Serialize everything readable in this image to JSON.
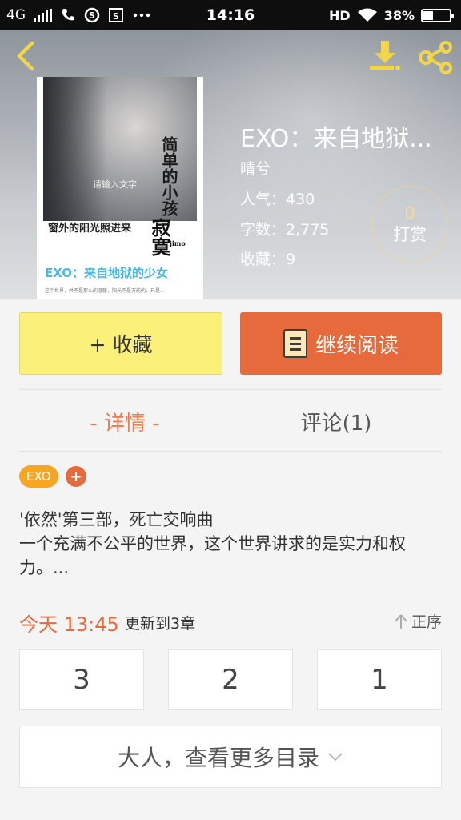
{
  "status_bar": {
    "network": "4G",
    "time": "14:16",
    "hd": "HD",
    "battery_percent": "38%",
    "battery_level": 0.38,
    "icons": [
      "signal-icon",
      "phone-icon",
      "skype-icon",
      "sim-icon",
      "more-dots-icon",
      "wifi-icon",
      "battery-icon"
    ]
  },
  "header": {
    "back_icon": "chevron-left-icon",
    "download_icon": "download-icon",
    "share_icon": "share-icon",
    "icon_color": "#f2d64a"
  },
  "cover": {
    "vertical_text": "简单的小孩",
    "small_text": "请输入文字",
    "line_text": "窗外的阳光照进来",
    "big_text": "寂寞",
    "big_sub": "jimo",
    "title": "EXO：来自地狱的少女",
    "tiny_text": "这个世界，并不是那么的温暖，阳光不是万能的，只是..."
  },
  "book": {
    "title": "EXO：来自地狱...",
    "author": "晴兮",
    "popularity": "人气：430",
    "word_count": "字数：2,775",
    "favorites": "收藏：9",
    "tip_count": "0",
    "tip_label": "打赏"
  },
  "actions": {
    "collect_label": "+ 收藏",
    "read_label": "继续阅读",
    "collect_color": "#fbf07a",
    "read_color": "#e66a3b"
  },
  "tabs": {
    "detail": "- 详情 -",
    "comments": "评论(1)"
  },
  "tags": {
    "items": [
      "EXO"
    ],
    "add_label": "+"
  },
  "description": "'依然'第三部，死亡交响曲\n一个充满不公平的世界，这个世界讲求的是实力和权力。...",
  "update": {
    "time": "今天 13:45",
    "text": "更新到3章",
    "order_label": "正序"
  },
  "chapters": [
    "3",
    "2",
    "1"
  ],
  "more_label": "大人，查看更多目录"
}
